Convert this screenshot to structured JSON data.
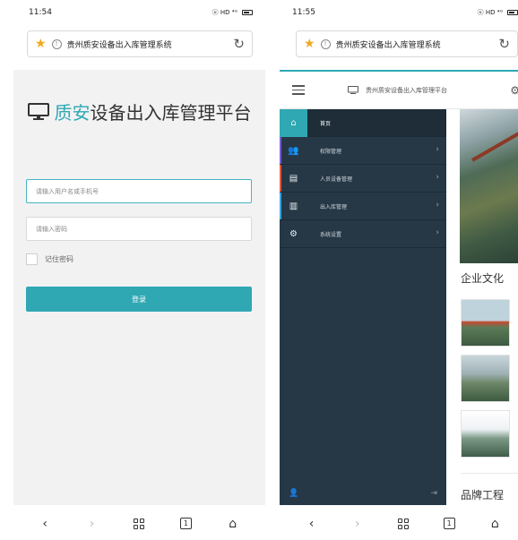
{
  "left": {
    "status": {
      "time": "11:54",
      "icons": "ⓤ HD ⁴ᴳ"
    },
    "url": "贵州质安设备出入库管理系统",
    "login": {
      "title_accent": "质安",
      "title_rest": "设备出入库管理平台",
      "username_placeholder": "请输入用户名或手机号",
      "password_placeholder": "请输入密码",
      "remember_label": "记住密码",
      "login_button": "登录"
    },
    "nav": {
      "back": "‹",
      "forward": "›",
      "tabs": "1"
    }
  },
  "right": {
    "status": {
      "time": "11:55",
      "icons": "ⓤ HD ⁴ᴳ"
    },
    "url": "贵州质安设备出入库管理系统",
    "header_title": "贵州质安设备出入库管理平台",
    "menu": [
      {
        "label": "首页",
        "icon": "home-icon",
        "glyph": "⌂",
        "active": true
      },
      {
        "label": "权限管理",
        "icon": "users-icon",
        "glyph": "👥",
        "active": false
      },
      {
        "label": "人员设备管理",
        "icon": "device-icon",
        "glyph": "▤",
        "active": false
      },
      {
        "label": "出入库管理",
        "icon": "chart-icon",
        "glyph": "▥",
        "active": false
      },
      {
        "label": "系统设置",
        "icon": "settings-icon",
        "glyph": "⚙",
        "active": false
      }
    ],
    "sections": {
      "culture": "企业文化",
      "brand": "品牌工程"
    },
    "nav": {
      "back": "‹",
      "forward": "›",
      "tabs": "1"
    }
  },
  "colors": {
    "accent": "#2fa8b4",
    "sidebar": "#263846",
    "star": "#f0a91e"
  }
}
